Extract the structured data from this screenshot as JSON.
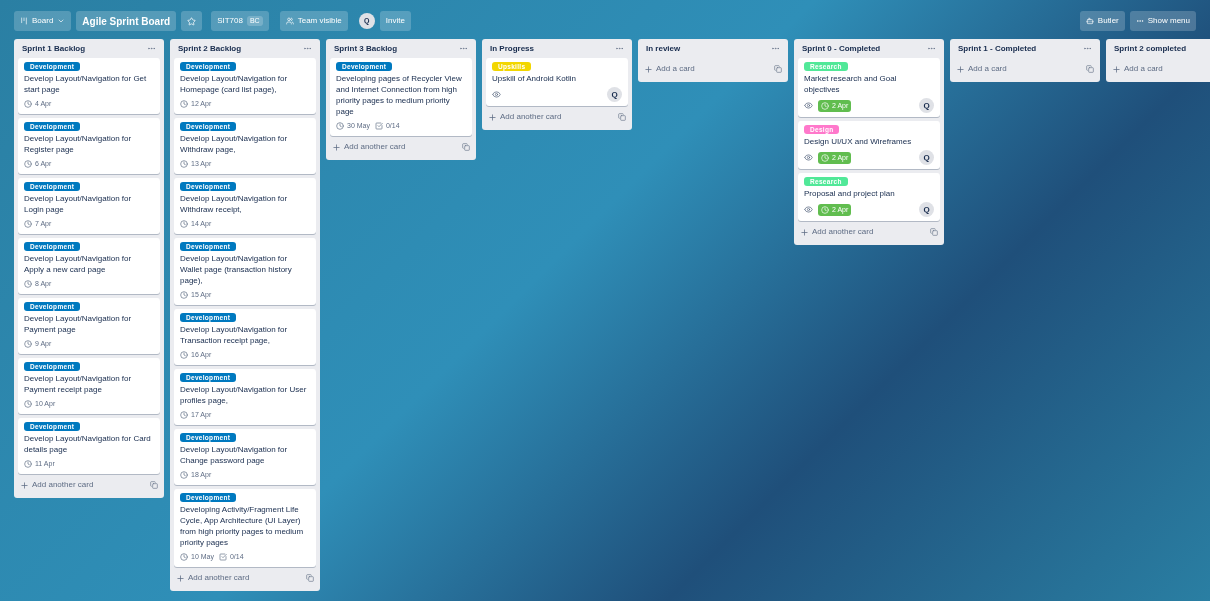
{
  "header": {
    "board_switcher": "Board",
    "title": "Agile Sprint Board",
    "workspace": "SIT708",
    "workspace_badge": "BC",
    "visibility": "Team visible",
    "member": "Q",
    "invite": "Invite",
    "butler": "Butler",
    "menu": "Show menu"
  },
  "lists": [
    {
      "title": "Sprint 1 Backlog",
      "add": "Add another card",
      "cards": [
        {
          "label": {
            "text": "Development",
            "color": "#0079bf"
          },
          "title": "Develop Layout/Navigation for Get start page",
          "date": "4 Apr",
          "due_complete": false,
          "watching": false
        },
        {
          "label": {
            "text": "Development",
            "color": "#0079bf"
          },
          "title": "Develop Layout/Navigation for Register page",
          "date": "6 Apr",
          "due_complete": false,
          "watching": false
        },
        {
          "label": {
            "text": "Development",
            "color": "#0079bf"
          },
          "title": "Develop Layout/Navigation for Login page",
          "date": "7 Apr",
          "due_complete": false,
          "watching": false
        },
        {
          "label": {
            "text": "Development",
            "color": "#0079bf"
          },
          "title": "Develop Layout/Navigation for Apply a new card page",
          "date": "8 Apr",
          "due_complete": false,
          "watching": false
        },
        {
          "label": {
            "text": "Development",
            "color": "#0079bf"
          },
          "title": "Develop Layout/Navigation for Payment page",
          "date": "9 Apr",
          "due_complete": false,
          "watching": false
        },
        {
          "label": {
            "text": "Development",
            "color": "#0079bf"
          },
          "title": "Develop Layout/Navigation for Payment receipt page",
          "date": "10 Apr",
          "due_complete": false,
          "watching": false
        },
        {
          "label": {
            "text": "Development",
            "color": "#0079bf"
          },
          "title": "Develop Layout/Navigation for Card details page",
          "date": "11 Apr",
          "due_complete": false,
          "watching": false
        }
      ]
    },
    {
      "title": "Sprint 2 Backlog",
      "add": "Add another card",
      "cards": [
        {
          "label": {
            "text": "Development",
            "color": "#0079bf"
          },
          "title": "Develop Layout/Navigation for Homepage (card list page),",
          "date": "12 Apr",
          "due_complete": false,
          "watching": false
        },
        {
          "label": {
            "text": "Development",
            "color": "#0079bf"
          },
          "title": "Develop Layout/Navigation for Withdraw page,",
          "date": "13 Apr",
          "due_complete": false,
          "watching": false
        },
        {
          "label": {
            "text": "Development",
            "color": "#0079bf"
          },
          "title": "Develop Layout/Navigation for Withdraw receipt,",
          "date": "14 Apr",
          "due_complete": false,
          "watching": false
        },
        {
          "label": {
            "text": "Development",
            "color": "#0079bf"
          },
          "title": "Develop Layout/Navigation for Wallet page (transaction history page),",
          "date": "15 Apr",
          "due_complete": false,
          "watching": false
        },
        {
          "label": {
            "text": "Development",
            "color": "#0079bf"
          },
          "title": "Develop Layout/Navigation for Transaction receipt page,",
          "date": "16 Apr",
          "due_complete": false,
          "watching": false
        },
        {
          "label": {
            "text": "Development",
            "color": "#0079bf"
          },
          "title": "Develop Layout/Navigation for User profiles page,",
          "date": "17 Apr",
          "due_complete": false,
          "watching": false
        },
        {
          "label": {
            "text": "Development",
            "color": "#0079bf"
          },
          "title": "Develop Layout/Navigation for Change password page",
          "date": "18 Apr",
          "due_complete": false,
          "watching": false
        },
        {
          "label": {
            "text": "Development",
            "color": "#0079bf"
          },
          "title": "Developing Activity/Fragment Life Cycle, App Architecture (UI Layer) from high priority pages to medium priority pages",
          "date": "10 May",
          "checklist": "0/14",
          "due_complete": false,
          "watching": false
        }
      ]
    },
    {
      "title": "Sprint 3 Backlog",
      "add": "Add another card",
      "cards": [
        {
          "label": {
            "text": "Development",
            "color": "#0079bf"
          },
          "title": "Developing pages of Recycler View and Internet Connection from high priority pages to medium priority page",
          "date": "30 May",
          "checklist": "0/14",
          "due_complete": false,
          "watching": false
        }
      ]
    },
    {
      "title": "In Progress",
      "add": "Add another card",
      "cards": [
        {
          "label": {
            "text": "Upskills",
            "color": "#f2d600"
          },
          "title": "Upskill of Android Kotlin",
          "watching": true,
          "member": "Q"
        }
      ]
    },
    {
      "title": "In review",
      "add": "Add a card"
    },
    {
      "title": "Sprint 0 - Completed",
      "add": "Add another card",
      "cards": [
        {
          "label": {
            "text": "Research",
            "color": "#51e898"
          },
          "title": "Market research and Goal objectives",
          "date": "2 Apr",
          "due_complete": true,
          "watching": true,
          "member": "Q"
        },
        {
          "label": {
            "text": "Design",
            "color": "#ff78cb"
          },
          "title": "Design UI/UX and Wireframes",
          "date": "2 Apr",
          "due_complete": true,
          "watching": true,
          "member": "Q"
        },
        {
          "label": {
            "text": "Research",
            "color": "#51e898"
          },
          "title": "Proposal and project plan",
          "date": "2 Apr",
          "due_complete": true,
          "watching": true,
          "member": "Q"
        }
      ]
    },
    {
      "title": "Sprint 1 - Completed",
      "add": "Add a card"
    },
    {
      "title": "Sprint 2 completed",
      "add": "Add a card"
    }
  ]
}
